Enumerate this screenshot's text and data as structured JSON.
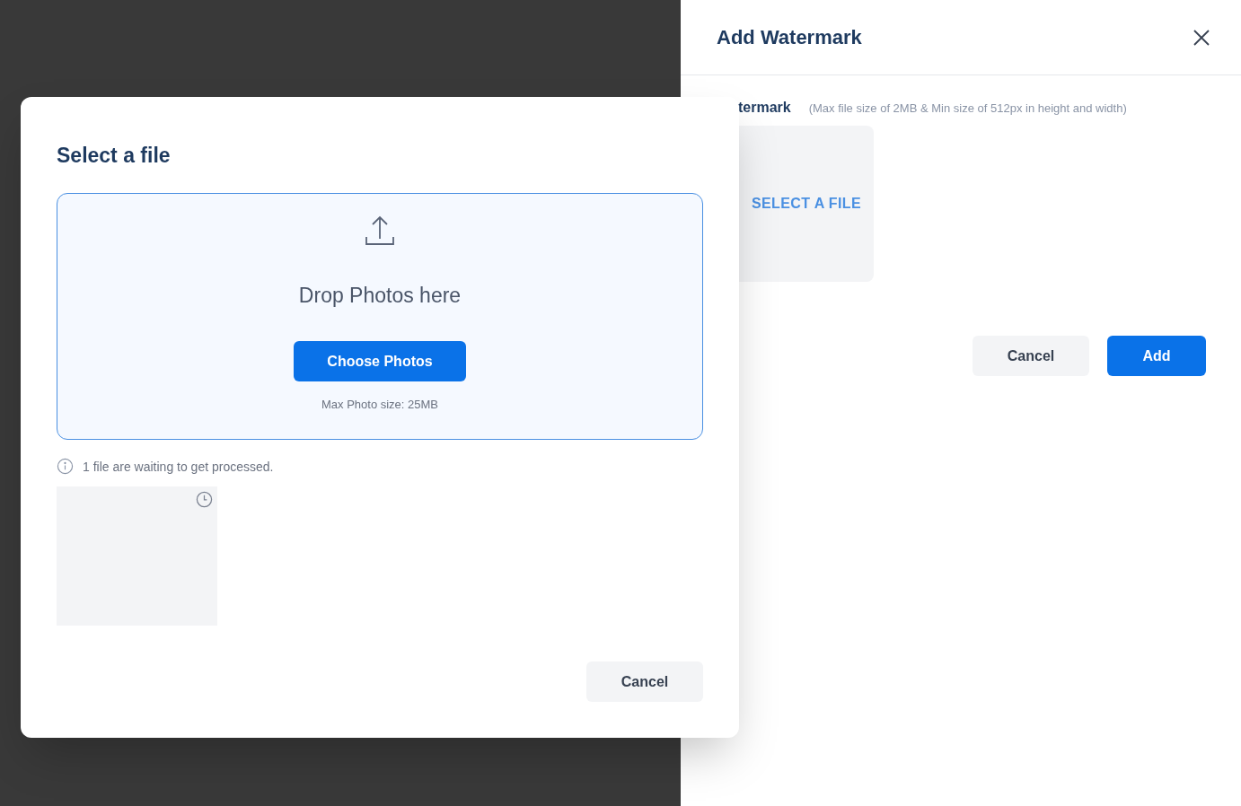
{
  "panel": {
    "title": "Add Watermark",
    "field_label": "termark",
    "field_hint": "(Max file size of 2MB & Min size of 512px in height and width)",
    "select_label": "SELECT A FILE",
    "buttons": [
      {
        "label": "Cancel",
        "kind": "secondary"
      },
      {
        "label": "Add",
        "kind": "primary"
      }
    ]
  },
  "modal": {
    "title": "Select a file",
    "dropzone": {
      "heading": "Drop Photos here",
      "button": "Choose Photos",
      "note": "Max Photo size: 25MB"
    },
    "info": "1 file are waiting to get processed.",
    "files": [
      {
        "pending": true
      }
    ],
    "buttons": [
      {
        "label": "Cancel",
        "kind": "secondary"
      }
    ]
  }
}
